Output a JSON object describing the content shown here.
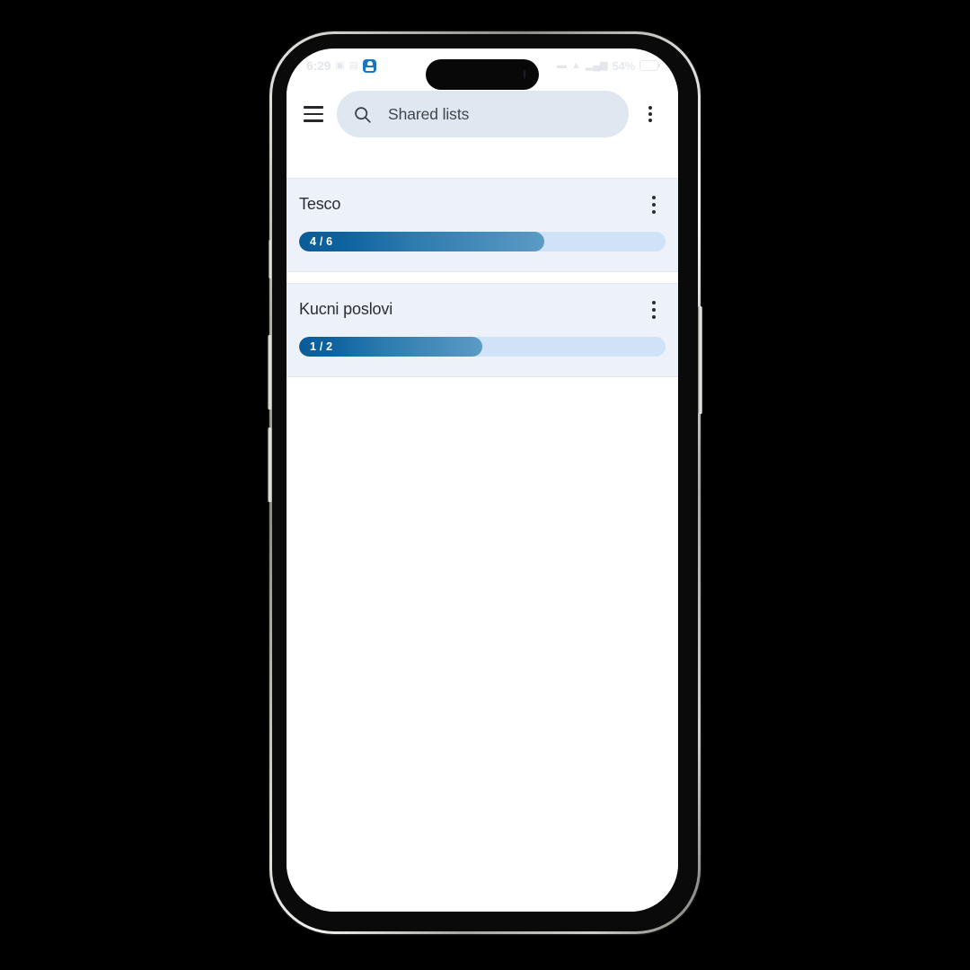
{
  "status_bar": {
    "time": "6:29",
    "app_badge_icon": "app-badge-icon",
    "battery_percent": "54%",
    "left_glyphs": [
      "▣",
      "▤"
    ],
    "right_glyphs": [
      "▬",
      "▲",
      "▂▄▆"
    ]
  },
  "app_bar": {
    "menu_icon": "hamburger-menu-icon",
    "search_icon": "search-icon",
    "search_value": "Shared lists",
    "search_placeholder": "Shared lists",
    "overflow_icon": "overflow-menu-icon"
  },
  "lists": [
    {
      "title": "Tesco",
      "progress_label": "4 / 6",
      "completed": 4,
      "total": 6,
      "percent": 67,
      "menu_icon": "card-overflow-menu-icon"
    },
    {
      "title": "Kucni poslovi",
      "progress_label": "1 / 2",
      "completed": 1,
      "total": 2,
      "percent": 50,
      "menu_icon": "card-overflow-menu-icon"
    }
  ],
  "colors": {
    "card_background": "#edf1f9",
    "search_background": "#dfe7f0",
    "progress_track": "#cfe2f8",
    "progress_start": "#0a5c96",
    "progress_end": "#5b9bc4",
    "text_primary": "#2a2d31"
  }
}
